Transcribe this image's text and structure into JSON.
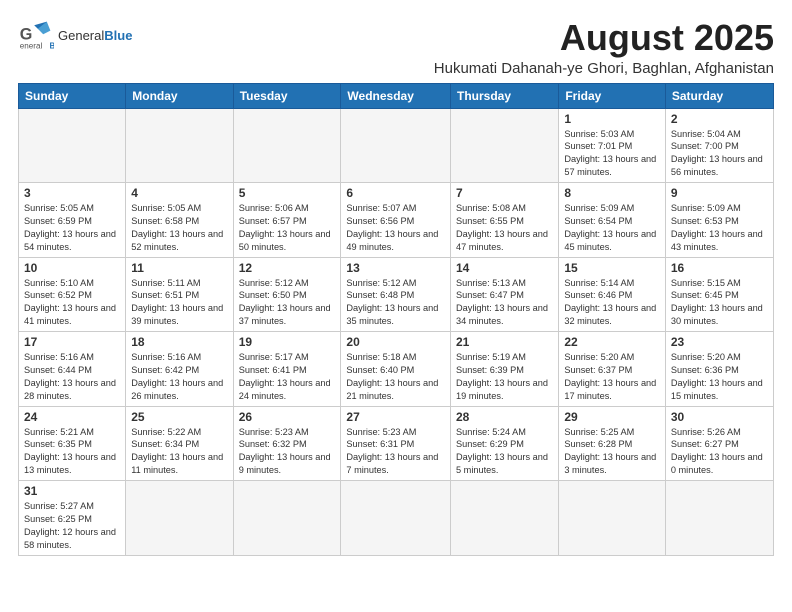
{
  "header": {
    "logo_general": "General",
    "logo_blue": "Blue",
    "month_title": "August 2025",
    "subtitle": "Hukumati Dahanah-ye Ghori, Baghlan, Afghanistan"
  },
  "weekdays": [
    "Sunday",
    "Monday",
    "Tuesday",
    "Wednesday",
    "Thursday",
    "Friday",
    "Saturday"
  ],
  "weeks": [
    [
      {
        "day": "",
        "info": ""
      },
      {
        "day": "",
        "info": ""
      },
      {
        "day": "",
        "info": ""
      },
      {
        "day": "",
        "info": ""
      },
      {
        "day": "",
        "info": ""
      },
      {
        "day": "1",
        "info": "Sunrise: 5:03 AM\nSunset: 7:01 PM\nDaylight: 13 hours and 57 minutes."
      },
      {
        "day": "2",
        "info": "Sunrise: 5:04 AM\nSunset: 7:00 PM\nDaylight: 13 hours and 56 minutes."
      }
    ],
    [
      {
        "day": "3",
        "info": "Sunrise: 5:05 AM\nSunset: 6:59 PM\nDaylight: 13 hours and 54 minutes."
      },
      {
        "day": "4",
        "info": "Sunrise: 5:05 AM\nSunset: 6:58 PM\nDaylight: 13 hours and 52 minutes."
      },
      {
        "day": "5",
        "info": "Sunrise: 5:06 AM\nSunset: 6:57 PM\nDaylight: 13 hours and 50 minutes."
      },
      {
        "day": "6",
        "info": "Sunrise: 5:07 AM\nSunset: 6:56 PM\nDaylight: 13 hours and 49 minutes."
      },
      {
        "day": "7",
        "info": "Sunrise: 5:08 AM\nSunset: 6:55 PM\nDaylight: 13 hours and 47 minutes."
      },
      {
        "day": "8",
        "info": "Sunrise: 5:09 AM\nSunset: 6:54 PM\nDaylight: 13 hours and 45 minutes."
      },
      {
        "day": "9",
        "info": "Sunrise: 5:09 AM\nSunset: 6:53 PM\nDaylight: 13 hours and 43 minutes."
      }
    ],
    [
      {
        "day": "10",
        "info": "Sunrise: 5:10 AM\nSunset: 6:52 PM\nDaylight: 13 hours and 41 minutes."
      },
      {
        "day": "11",
        "info": "Sunrise: 5:11 AM\nSunset: 6:51 PM\nDaylight: 13 hours and 39 minutes."
      },
      {
        "day": "12",
        "info": "Sunrise: 5:12 AM\nSunset: 6:50 PM\nDaylight: 13 hours and 37 minutes."
      },
      {
        "day": "13",
        "info": "Sunrise: 5:12 AM\nSunset: 6:48 PM\nDaylight: 13 hours and 35 minutes."
      },
      {
        "day": "14",
        "info": "Sunrise: 5:13 AM\nSunset: 6:47 PM\nDaylight: 13 hours and 34 minutes."
      },
      {
        "day": "15",
        "info": "Sunrise: 5:14 AM\nSunset: 6:46 PM\nDaylight: 13 hours and 32 minutes."
      },
      {
        "day": "16",
        "info": "Sunrise: 5:15 AM\nSunset: 6:45 PM\nDaylight: 13 hours and 30 minutes."
      }
    ],
    [
      {
        "day": "17",
        "info": "Sunrise: 5:16 AM\nSunset: 6:44 PM\nDaylight: 13 hours and 28 minutes."
      },
      {
        "day": "18",
        "info": "Sunrise: 5:16 AM\nSunset: 6:42 PM\nDaylight: 13 hours and 26 minutes."
      },
      {
        "day": "19",
        "info": "Sunrise: 5:17 AM\nSunset: 6:41 PM\nDaylight: 13 hours and 24 minutes."
      },
      {
        "day": "20",
        "info": "Sunrise: 5:18 AM\nSunset: 6:40 PM\nDaylight: 13 hours and 21 minutes."
      },
      {
        "day": "21",
        "info": "Sunrise: 5:19 AM\nSunset: 6:39 PM\nDaylight: 13 hours and 19 minutes."
      },
      {
        "day": "22",
        "info": "Sunrise: 5:20 AM\nSunset: 6:37 PM\nDaylight: 13 hours and 17 minutes."
      },
      {
        "day": "23",
        "info": "Sunrise: 5:20 AM\nSunset: 6:36 PM\nDaylight: 13 hours and 15 minutes."
      }
    ],
    [
      {
        "day": "24",
        "info": "Sunrise: 5:21 AM\nSunset: 6:35 PM\nDaylight: 13 hours and 13 minutes."
      },
      {
        "day": "25",
        "info": "Sunrise: 5:22 AM\nSunset: 6:34 PM\nDaylight: 13 hours and 11 minutes."
      },
      {
        "day": "26",
        "info": "Sunrise: 5:23 AM\nSunset: 6:32 PM\nDaylight: 13 hours and 9 minutes."
      },
      {
        "day": "27",
        "info": "Sunrise: 5:23 AM\nSunset: 6:31 PM\nDaylight: 13 hours and 7 minutes."
      },
      {
        "day": "28",
        "info": "Sunrise: 5:24 AM\nSunset: 6:29 PM\nDaylight: 13 hours and 5 minutes."
      },
      {
        "day": "29",
        "info": "Sunrise: 5:25 AM\nSunset: 6:28 PM\nDaylight: 13 hours and 3 minutes."
      },
      {
        "day": "30",
        "info": "Sunrise: 5:26 AM\nSunset: 6:27 PM\nDaylight: 13 hours and 0 minutes."
      }
    ],
    [
      {
        "day": "31",
        "info": "Sunrise: 5:27 AM\nSunset: 6:25 PM\nDaylight: 12 hours and 58 minutes."
      },
      {
        "day": "",
        "info": ""
      },
      {
        "day": "",
        "info": ""
      },
      {
        "day": "",
        "info": ""
      },
      {
        "day": "",
        "info": ""
      },
      {
        "day": "",
        "info": ""
      },
      {
        "day": "",
        "info": ""
      }
    ]
  ]
}
